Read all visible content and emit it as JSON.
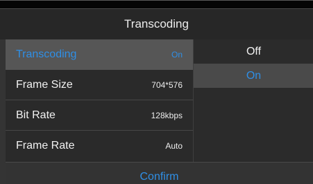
{
  "header": {
    "title": "Transcoding"
  },
  "settings": {
    "items": [
      {
        "label": "Transcoding",
        "value": "On",
        "selected": true
      },
      {
        "label": "Frame Size",
        "value": "704*576"
      },
      {
        "label": "Bit Rate",
        "value": "128kbps"
      },
      {
        "label": "Frame Rate",
        "value": "Auto"
      }
    ]
  },
  "options": {
    "items": [
      {
        "label": "Off"
      },
      {
        "label": "On",
        "selected": true
      }
    ]
  },
  "footer": {
    "confirm_label": "Confirm"
  },
  "colors": {
    "accent": "#2f8fe6",
    "background": "#343434",
    "selected_row": "#565656"
  }
}
